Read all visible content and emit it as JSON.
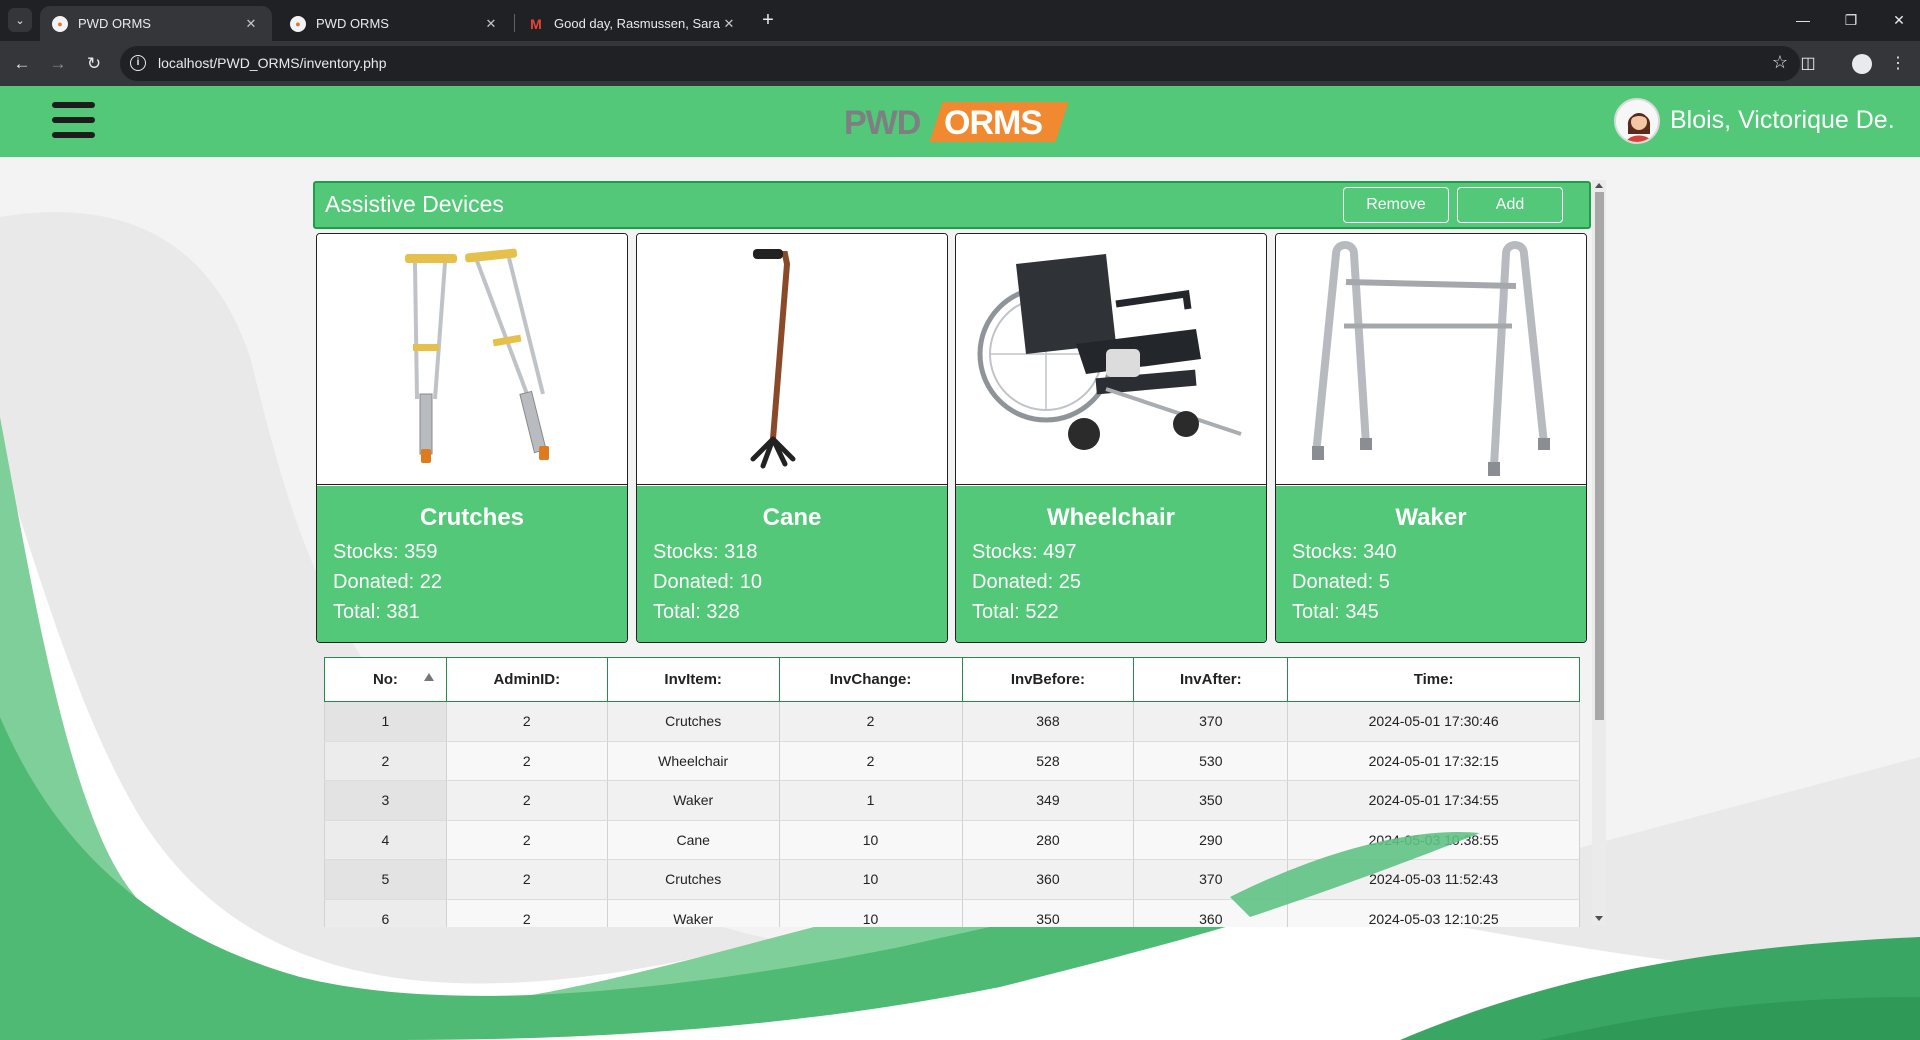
{
  "browser": {
    "tabs": [
      {
        "title": "PWD ORMS",
        "active": true,
        "favicon": "pwd-orms-favicon-icon"
      },
      {
        "title": "PWD ORMS",
        "active": false,
        "favicon": "pwd-orms-favicon-icon"
      },
      {
        "title": "Good day, Rasmussen, Sara Au",
        "active": false,
        "favicon": "gmail-icon"
      }
    ],
    "url": "localhost/PWD_ORMS/inventory.php"
  },
  "header": {
    "logo_left": "PWD",
    "logo_right": "ORMS",
    "user_name": "Blois, Victorique De.",
    "brand_green": "#52c878",
    "brand_orange": "#f0892f"
  },
  "panel": {
    "title": "Assistive Devices",
    "remove_label": "Remove",
    "add_label": "Add"
  },
  "devices": [
    {
      "name": "Crutches",
      "stocks": "Stocks: 359",
      "donated": "Donated: 22",
      "total": "Total: 381",
      "image": "crutches-image"
    },
    {
      "name": "Cane",
      "stocks": "Stocks: 318",
      "donated": "Donated: 10",
      "total": "Total: 328",
      "image": "cane-image"
    },
    {
      "name": "Wheelchair",
      "stocks": "Stocks: 497",
      "donated": "Donated: 25",
      "total": "Total: 522",
      "image": "wheelchair-image"
    },
    {
      "name": "Waker",
      "stocks": "Stocks: 340",
      "donated": "Donated: 5",
      "total": "Total: 345",
      "image": "walker-image"
    }
  ],
  "table": {
    "headers": [
      "No:",
      "AdminID:",
      "InvItem:",
      "InvChange:",
      "InvBefore:",
      "InvAfter:",
      "Time:"
    ],
    "sorted_column": "No:",
    "sort_direction": "ascending",
    "rows": [
      [
        "1",
        "2",
        "Crutches",
        "2",
        "368",
        "370",
        "2024-05-01 17:30:46"
      ],
      [
        "2",
        "2",
        "Wheelchair",
        "2",
        "528",
        "530",
        "2024-05-01 17:32:15"
      ],
      [
        "3",
        "2",
        "Waker",
        "1",
        "349",
        "350",
        "2024-05-01 17:34:55"
      ],
      [
        "4",
        "2",
        "Cane",
        "10",
        "280",
        "290",
        "2024-05-03 10:38:55"
      ],
      [
        "5",
        "2",
        "Crutches",
        "10",
        "360",
        "370",
        "2024-05-03 11:52:43"
      ],
      [
        "6",
        "2",
        "Waker",
        "10",
        "350",
        "360",
        "2024-05-03 12:10:25"
      ]
    ]
  }
}
